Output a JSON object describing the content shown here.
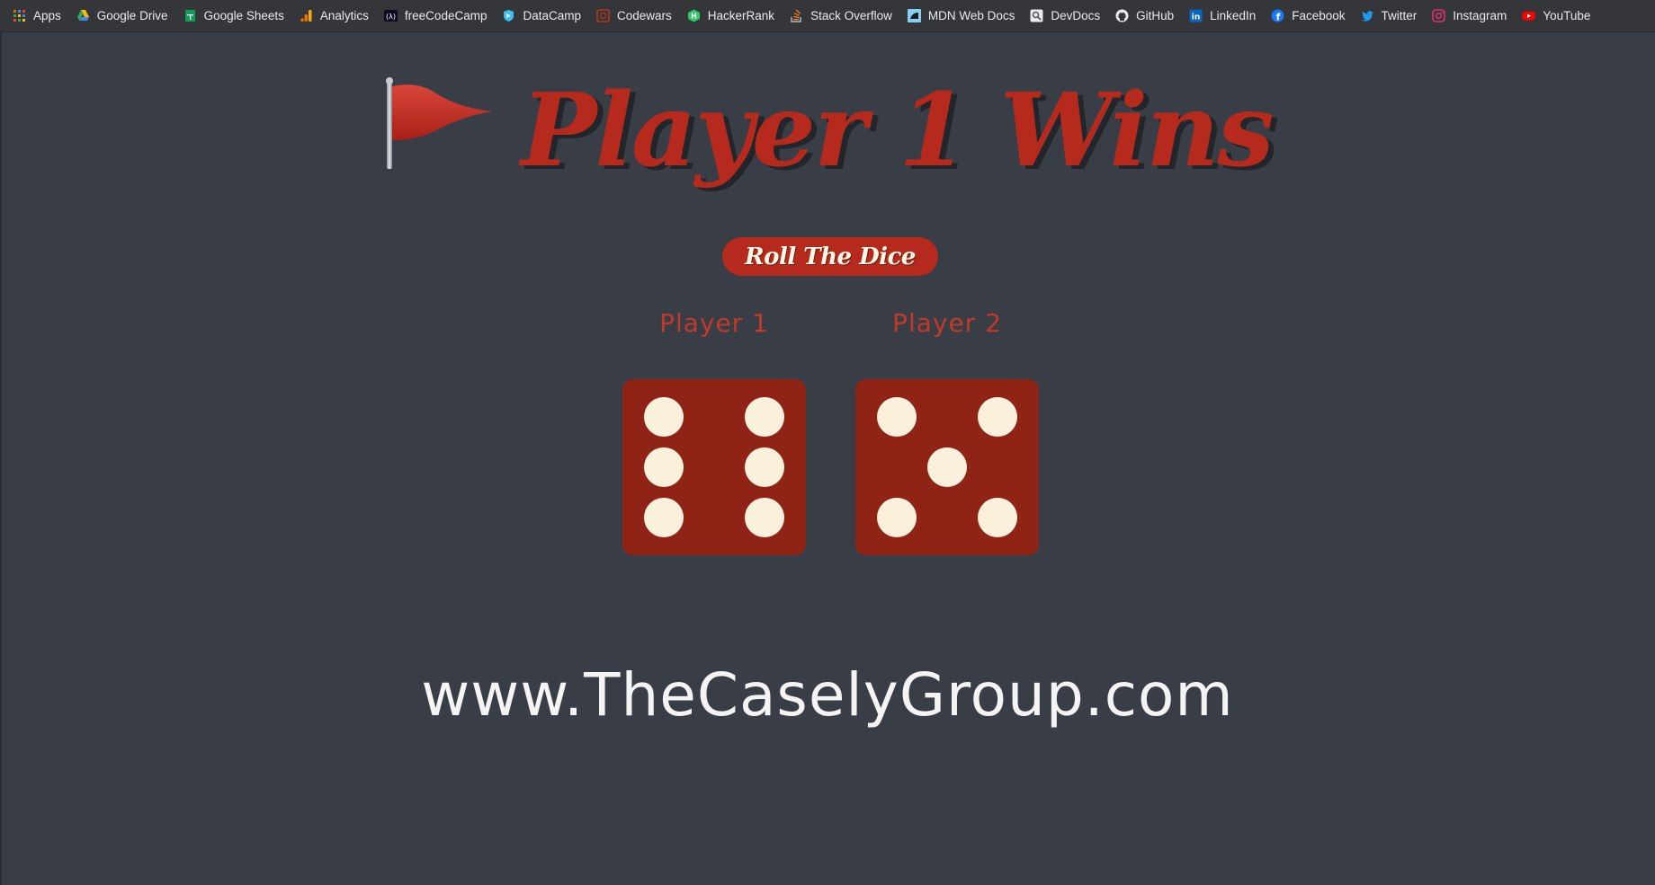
{
  "bookmarks": [
    {
      "label": "Apps",
      "icon": "apps-grid-icon"
    },
    {
      "label": "Google Drive",
      "icon": "google-drive-icon"
    },
    {
      "label": "Google Sheets",
      "icon": "google-sheets-icon"
    },
    {
      "label": "Analytics",
      "icon": "analytics-icon"
    },
    {
      "label": "freeCodeCamp",
      "icon": "freecodecamp-icon"
    },
    {
      "label": "DataCamp",
      "icon": "datacamp-icon"
    },
    {
      "label": "Codewars",
      "icon": "codewars-icon"
    },
    {
      "label": "HackerRank",
      "icon": "hackerrank-icon"
    },
    {
      "label": "Stack Overflow",
      "icon": "stackoverflow-icon"
    },
    {
      "label": "MDN Web Docs",
      "icon": "mdn-icon"
    },
    {
      "label": "DevDocs",
      "icon": "devdocs-icon"
    },
    {
      "label": "GitHub",
      "icon": "github-icon"
    },
    {
      "label": "LinkedIn",
      "icon": "linkedin-icon"
    },
    {
      "label": "Facebook",
      "icon": "facebook-icon"
    },
    {
      "label": "Twitter",
      "icon": "twitter-icon"
    },
    {
      "label": "Instagram",
      "icon": "instagram-icon"
    },
    {
      "label": "YouTube",
      "icon": "youtube-icon"
    }
  ],
  "game": {
    "title": "Player 1 Wins",
    "title_icon": "red-flag-icon",
    "roll_button": "Roll The Dice",
    "player1_label": "Player 1",
    "player2_label": "Player 2",
    "player1_die_value": 6,
    "player2_die_value": 5
  },
  "footer": {
    "site": "www.TheCaselyGroup.com"
  },
  "colors": {
    "accent": "#b52a1c",
    "die": "#8f2316",
    "pip": "#fbf0dc",
    "background": "#393e46"
  }
}
